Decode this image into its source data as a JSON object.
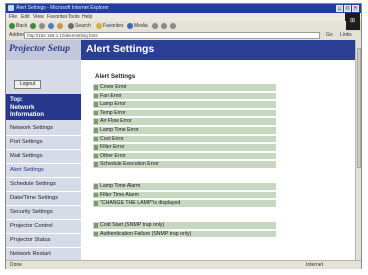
{
  "browser": {
    "window_title": "Alert Settings - Microsoft Internet Explorer",
    "menu": [
      "File",
      "Edit",
      "View",
      "Favorites",
      "Tools",
      "Help"
    ],
    "toolbar": {
      "back": "Back",
      "search": "Search",
      "favorites": "Favorites",
      "media": "Media"
    },
    "address_label": "Address",
    "address_value": "http://192.168.1.10/alertsetting.html",
    "go_label": "Go",
    "links_label": "Links",
    "status_text": "Done",
    "zone_text": "Internet"
  },
  "app": {
    "logo_text": "Projector Setup",
    "page_title": "Alert Settings"
  },
  "sidebar": {
    "logout_label": "Logout",
    "top_lines": [
      "Top:",
      "Network",
      "Information"
    ],
    "items": [
      {
        "label": "Network Settings",
        "selected": false
      },
      {
        "label": "Port Settings",
        "selected": false
      },
      {
        "label": "Mail Settings",
        "selected": false
      },
      {
        "label": "Alert Settings",
        "selected": true
      },
      {
        "label": "Schedule Settings",
        "selected": false
      },
      {
        "label": "Date/Time Settings",
        "selected": false
      },
      {
        "label": "Security Settings",
        "selected": false
      },
      {
        "label": "Projector Control",
        "selected": false
      },
      {
        "label": "Projector Status",
        "selected": false
      },
      {
        "label": "Network Restart",
        "selected": false
      }
    ]
  },
  "main": {
    "section_title": "Alert Settings",
    "group1": [
      "Cover Error",
      "Fan Error",
      "Lamp Error",
      "Temp Error",
      "Air Flow Error",
      "Lamp Time Error",
      "Cool Error",
      "Filter Error",
      "Other Error",
      "Schedule Execution Error"
    ],
    "group2": [
      "Lamp Time Alarm",
      "Filter Time Alarm",
      "\"CHANGE THE LAMP\"is displayed"
    ],
    "group3": [
      "Cold Start (SNMP trap only)",
      "Authentication Failure (SNMP trap only)"
    ]
  },
  "colors": {
    "header_bar": "#2a3f94",
    "nav_selected_bg": "#27378b",
    "sidebar_bg": "#d7dbe8",
    "row_bg": "#c6d8c0"
  }
}
